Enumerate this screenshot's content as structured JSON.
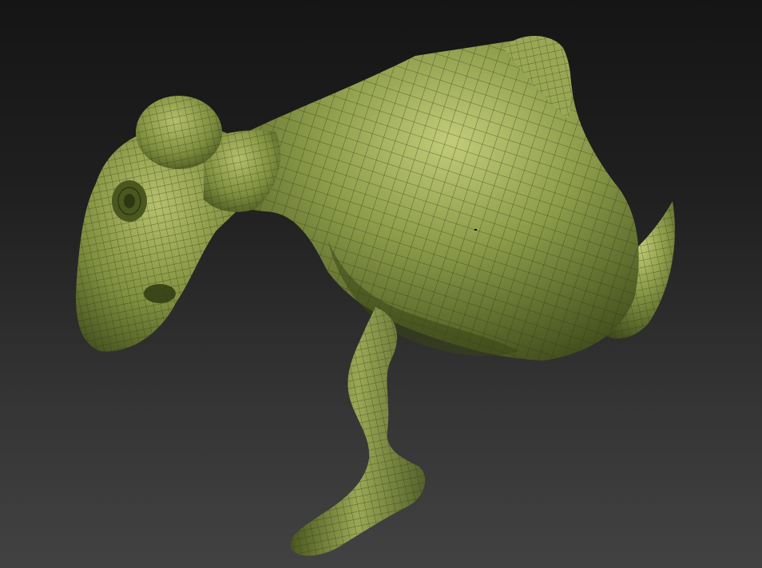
{
  "scene": {
    "subject": "sculpt-mesh",
    "colors": {
      "background_top": "#151515",
      "background_bottom": "#424242",
      "mesh_base": "#8a9a48",
      "mesh_highlight": "#c2cc78",
      "mesh_shadow": "#3e4a1a",
      "wire": "#263012"
    }
  }
}
